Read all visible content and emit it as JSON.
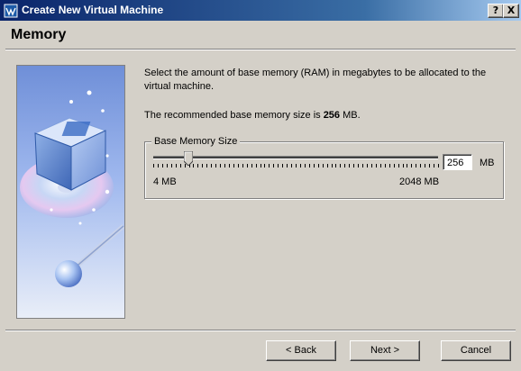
{
  "window": {
    "title": "Create New Virtual Machine",
    "help_label": "?",
    "close_label": "X"
  },
  "page": {
    "heading": "Memory",
    "description": "Select the amount of base memory (RAM) in megabytes to be allocated to the virtual machine.",
    "recommendation_prefix": "The recommended base memory size is ",
    "recommendation_value": "256",
    "recommendation_suffix": " MB."
  },
  "memory": {
    "group_label": "Base Memory Size",
    "value": "256",
    "unit": "MB",
    "min_label": "4 MB",
    "max_label": "2048 MB",
    "min_mb": 4,
    "max_mb": 2048,
    "current_mb": 256
  },
  "buttons": {
    "back": "< Back",
    "next": "Next >",
    "cancel": "Cancel"
  },
  "colors": {
    "titlebar_start": "#0a246a",
    "titlebar_end": "#a6caf0",
    "face": "#d4d0c8"
  },
  "icons": {
    "app": "virtualbox-icon",
    "illustration": "virtualbox-cube-illustration"
  }
}
